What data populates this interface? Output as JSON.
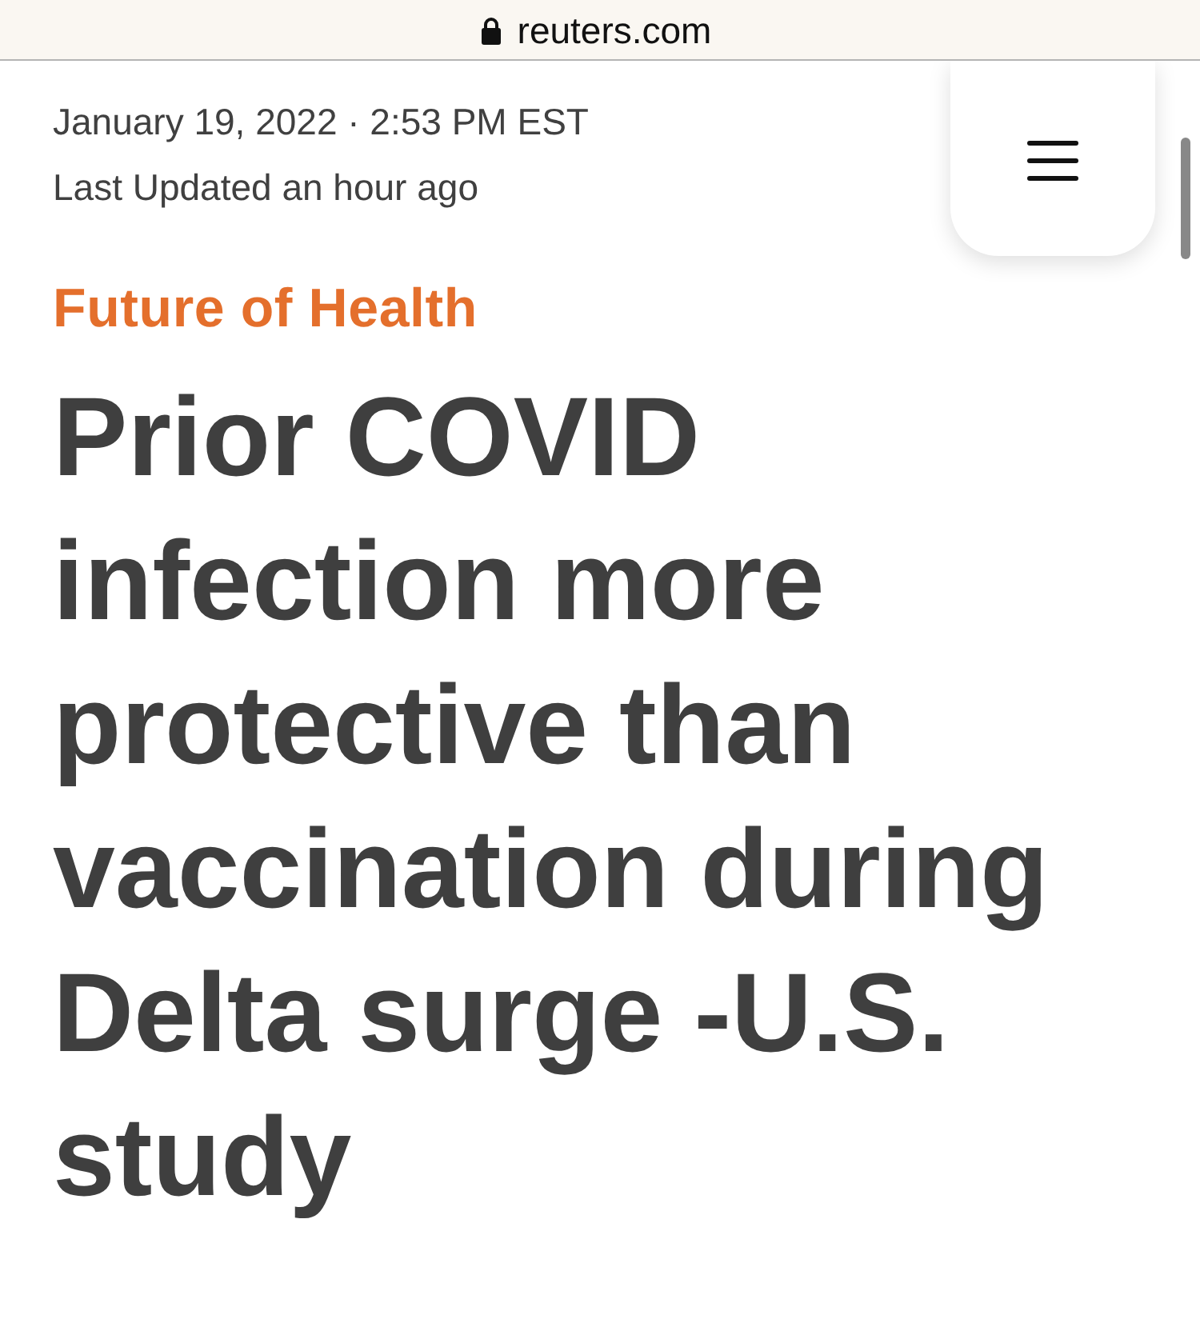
{
  "browser_bar": {
    "url": "reuters.com"
  },
  "article": {
    "timestamp": "January 19, 2022 · 2:53 PM EST",
    "updated": "Last Updated an hour ago",
    "section": "Future of Health",
    "headline": "Prior COVID infection more protective than vaccination during Delta surge -U.S. study"
  }
}
